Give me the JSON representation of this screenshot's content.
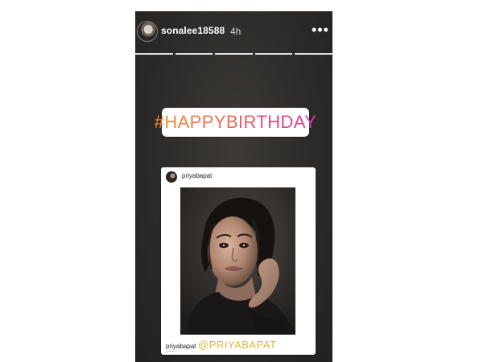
{
  "story": {
    "username": "sonalee18588",
    "time_ago": "4h",
    "more_icon": "more-options-icon",
    "progress_segments": 5
  },
  "sticker": {
    "text": "#HAPPYBIRTHDAY",
    "gradient_colors": [
      "#f58f3c",
      "#f16b4d",
      "#e64586",
      "#d33ba7"
    ]
  },
  "post": {
    "username": "priyabapat",
    "caption_username": "priyabapat",
    "mention": "@PRIYABAPAT",
    "mention_color": "#e0b93f"
  }
}
